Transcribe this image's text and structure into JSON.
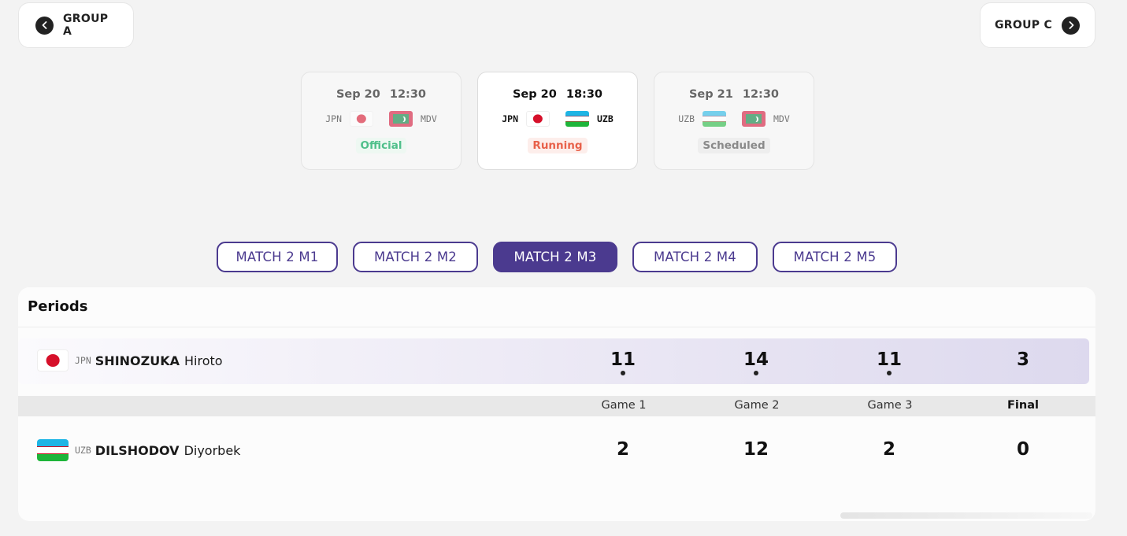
{
  "nav": {
    "prev_label": "GROUP A",
    "next_label": "GROUP C"
  },
  "schedule": [
    {
      "date": "Sep 20",
      "time": "12:30",
      "home": "JPN",
      "home_flag": "jpn",
      "away": "MDV",
      "away_flag": "mdv",
      "status": "Official",
      "status_color": "#4fbf8a"
    },
    {
      "date": "Sep 20",
      "time": "18:30",
      "home": "JPN",
      "home_flag": "jpn",
      "away": "UZB",
      "away_flag": "uzb",
      "status": "Running",
      "status_color": "#e8614a"
    },
    {
      "date": "Sep 21",
      "time": "12:30",
      "home": "UZB",
      "home_flag": "uzb",
      "away": "MDV",
      "away_flag": "mdv",
      "status": "Scheduled",
      "status_color": "#8a8a8a"
    }
  ],
  "match_tabs": [
    "MATCH 2 M1",
    "MATCH 2 M2",
    "MATCH 2 M3",
    "MATCH 2 M4",
    "MATCH 2 M5"
  ],
  "active_tab": "MATCH 2 M3",
  "periods": {
    "title": "Periods",
    "game_labels": [
      "Game 1",
      "Game 2",
      "Game 3"
    ],
    "final_label": "Final",
    "players": [
      {
        "code": "JPN",
        "flag": "jpn",
        "surname": "SHINOZUKA",
        "given": "Hiroto",
        "games": [
          "11",
          "14",
          "11"
        ],
        "final": "3"
      },
      {
        "code": "UZB",
        "flag": "uzb",
        "surname": "DILSHODOV",
        "given": "Diyorbek",
        "games": [
          "2",
          "12",
          "2"
        ],
        "final": "0"
      }
    ]
  },
  "colors": {
    "accent": "#4b3a8f",
    "official": "#4fbf8a",
    "running": "#e8614a",
    "scheduled": "#8a8a8a"
  }
}
